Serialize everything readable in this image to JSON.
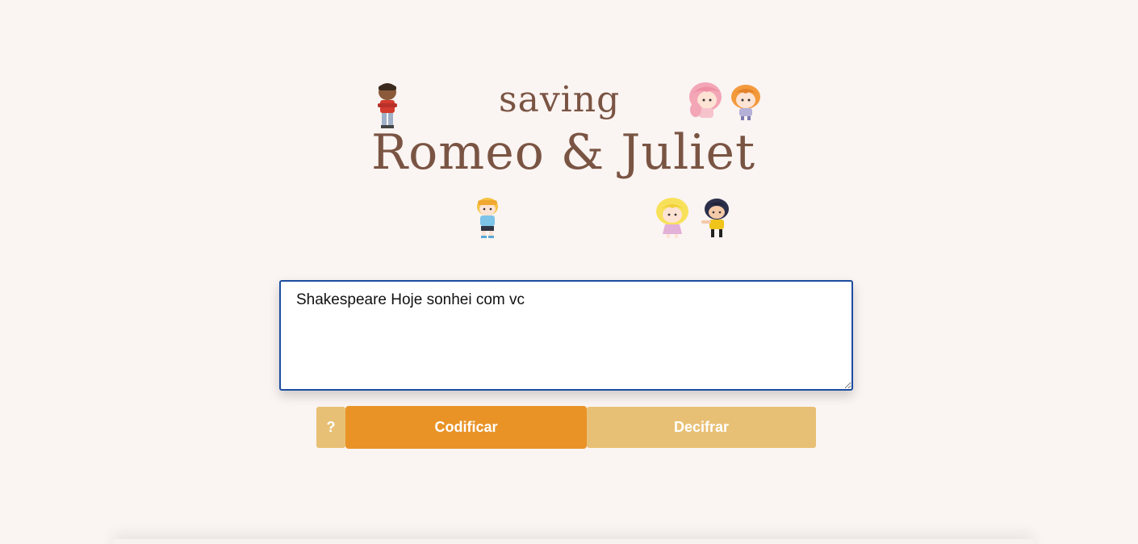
{
  "logo": {
    "subtitle": "saving",
    "title": "Romeo & Juliet"
  },
  "editor": {
    "value": "Shakespeare Hoje sonhei com vc"
  },
  "buttons": {
    "help_label": "?",
    "encode_label": "Codificar",
    "decode_label": "Decifrar"
  },
  "colors": {
    "background": "#faf4f2",
    "logo_text": "#7a5443",
    "primary_button": "#e99327",
    "secondary_button": "#e8c075",
    "textarea_border": "#1c4da0"
  }
}
